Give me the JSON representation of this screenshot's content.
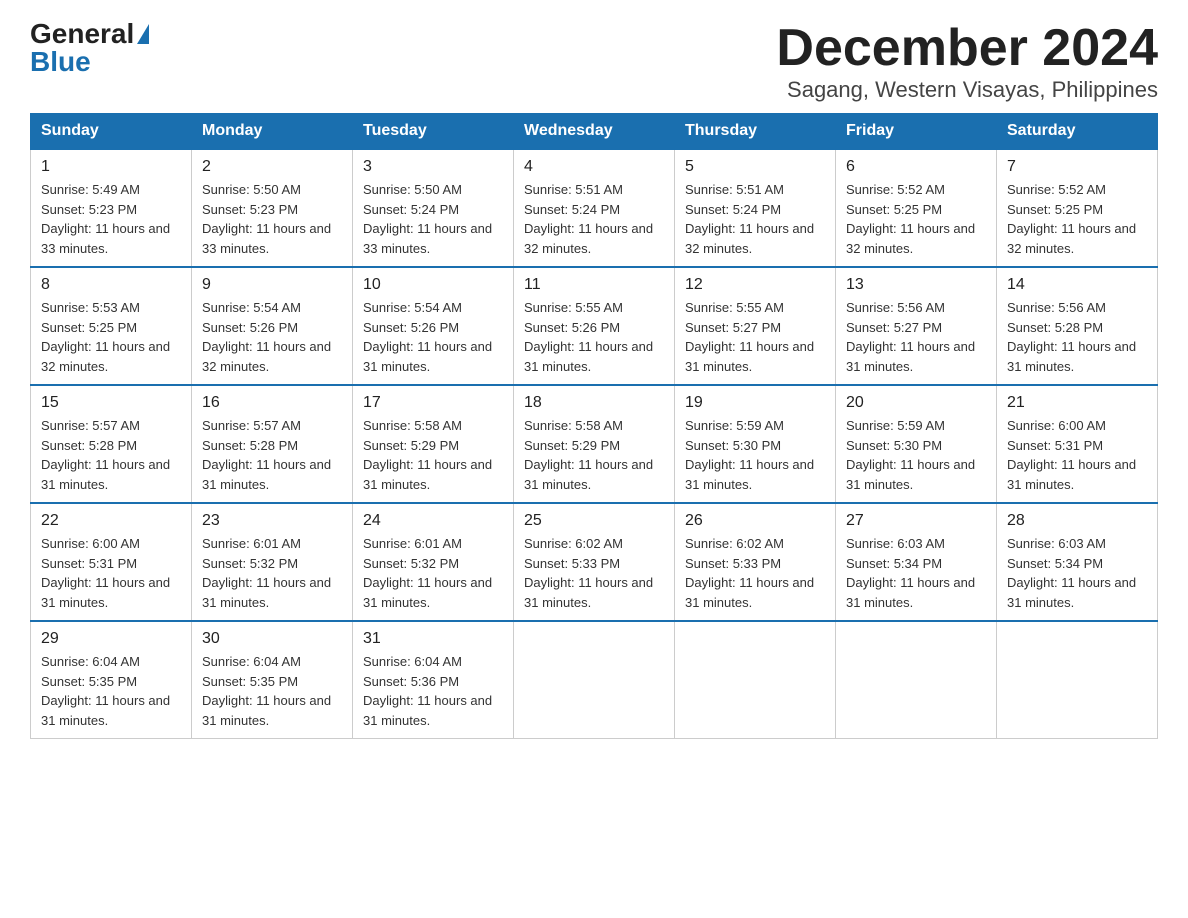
{
  "logo": {
    "general": "General",
    "blue": "Blue",
    "triangle": "▲"
  },
  "title": "December 2024",
  "subtitle": "Sagang, Western Visayas, Philippines",
  "weekdays": [
    "Sunday",
    "Monday",
    "Tuesday",
    "Wednesday",
    "Thursday",
    "Friday",
    "Saturday"
  ],
  "weeks": [
    [
      {
        "day": 1,
        "sunrise": "5:49 AM",
        "sunset": "5:23 PM",
        "daylight": "11 hours and 33 minutes."
      },
      {
        "day": 2,
        "sunrise": "5:50 AM",
        "sunset": "5:23 PM",
        "daylight": "11 hours and 33 minutes."
      },
      {
        "day": 3,
        "sunrise": "5:50 AM",
        "sunset": "5:24 PM",
        "daylight": "11 hours and 33 minutes."
      },
      {
        "day": 4,
        "sunrise": "5:51 AM",
        "sunset": "5:24 PM",
        "daylight": "11 hours and 32 minutes."
      },
      {
        "day": 5,
        "sunrise": "5:51 AM",
        "sunset": "5:24 PM",
        "daylight": "11 hours and 32 minutes."
      },
      {
        "day": 6,
        "sunrise": "5:52 AM",
        "sunset": "5:25 PM",
        "daylight": "11 hours and 32 minutes."
      },
      {
        "day": 7,
        "sunrise": "5:52 AM",
        "sunset": "5:25 PM",
        "daylight": "11 hours and 32 minutes."
      }
    ],
    [
      {
        "day": 8,
        "sunrise": "5:53 AM",
        "sunset": "5:25 PM",
        "daylight": "11 hours and 32 minutes."
      },
      {
        "day": 9,
        "sunrise": "5:54 AM",
        "sunset": "5:26 PM",
        "daylight": "11 hours and 32 minutes."
      },
      {
        "day": 10,
        "sunrise": "5:54 AM",
        "sunset": "5:26 PM",
        "daylight": "11 hours and 31 minutes."
      },
      {
        "day": 11,
        "sunrise": "5:55 AM",
        "sunset": "5:26 PM",
        "daylight": "11 hours and 31 minutes."
      },
      {
        "day": 12,
        "sunrise": "5:55 AM",
        "sunset": "5:27 PM",
        "daylight": "11 hours and 31 minutes."
      },
      {
        "day": 13,
        "sunrise": "5:56 AM",
        "sunset": "5:27 PM",
        "daylight": "11 hours and 31 minutes."
      },
      {
        "day": 14,
        "sunrise": "5:56 AM",
        "sunset": "5:28 PM",
        "daylight": "11 hours and 31 minutes."
      }
    ],
    [
      {
        "day": 15,
        "sunrise": "5:57 AM",
        "sunset": "5:28 PM",
        "daylight": "11 hours and 31 minutes."
      },
      {
        "day": 16,
        "sunrise": "5:57 AM",
        "sunset": "5:28 PM",
        "daylight": "11 hours and 31 minutes."
      },
      {
        "day": 17,
        "sunrise": "5:58 AM",
        "sunset": "5:29 PM",
        "daylight": "11 hours and 31 minutes."
      },
      {
        "day": 18,
        "sunrise": "5:58 AM",
        "sunset": "5:29 PM",
        "daylight": "11 hours and 31 minutes."
      },
      {
        "day": 19,
        "sunrise": "5:59 AM",
        "sunset": "5:30 PM",
        "daylight": "11 hours and 31 minutes."
      },
      {
        "day": 20,
        "sunrise": "5:59 AM",
        "sunset": "5:30 PM",
        "daylight": "11 hours and 31 minutes."
      },
      {
        "day": 21,
        "sunrise": "6:00 AM",
        "sunset": "5:31 PM",
        "daylight": "11 hours and 31 minutes."
      }
    ],
    [
      {
        "day": 22,
        "sunrise": "6:00 AM",
        "sunset": "5:31 PM",
        "daylight": "11 hours and 31 minutes."
      },
      {
        "day": 23,
        "sunrise": "6:01 AM",
        "sunset": "5:32 PM",
        "daylight": "11 hours and 31 minutes."
      },
      {
        "day": 24,
        "sunrise": "6:01 AM",
        "sunset": "5:32 PM",
        "daylight": "11 hours and 31 minutes."
      },
      {
        "day": 25,
        "sunrise": "6:02 AM",
        "sunset": "5:33 PM",
        "daylight": "11 hours and 31 minutes."
      },
      {
        "day": 26,
        "sunrise": "6:02 AM",
        "sunset": "5:33 PM",
        "daylight": "11 hours and 31 minutes."
      },
      {
        "day": 27,
        "sunrise": "6:03 AM",
        "sunset": "5:34 PM",
        "daylight": "11 hours and 31 minutes."
      },
      {
        "day": 28,
        "sunrise": "6:03 AM",
        "sunset": "5:34 PM",
        "daylight": "11 hours and 31 minutes."
      }
    ],
    [
      {
        "day": 29,
        "sunrise": "6:04 AM",
        "sunset": "5:35 PM",
        "daylight": "11 hours and 31 minutes."
      },
      {
        "day": 30,
        "sunrise": "6:04 AM",
        "sunset": "5:35 PM",
        "daylight": "11 hours and 31 minutes."
      },
      {
        "day": 31,
        "sunrise": "6:04 AM",
        "sunset": "5:36 PM",
        "daylight": "11 hours and 31 minutes."
      },
      null,
      null,
      null,
      null
    ]
  ],
  "colors": {
    "header_bg": "#1a6faf",
    "header_text": "#ffffff",
    "border": "#ccc",
    "accent": "#1a6faf"
  }
}
